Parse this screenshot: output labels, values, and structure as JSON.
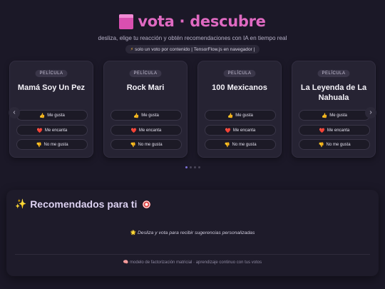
{
  "header": {
    "title": "vota · descubre",
    "tagline": "desliza, elige tu reacción y obtén recomendaciones con IA en tiempo real",
    "pill_text": "solo un voto por contenido | TensorFlow.js en navegador |",
    "pill_icon": "⚡"
  },
  "cards": [
    {
      "badge": "PELÍCULA",
      "title": "Mamá Soy Un Pez"
    },
    {
      "badge": "PELÍCULA",
      "title": "Rock Mari"
    },
    {
      "badge": "PELÍCULA",
      "title": "100 Mexicanos"
    },
    {
      "badge": "PELÍCULA",
      "title": "La Leyenda de La Nahuala"
    }
  ],
  "reactions": {
    "like": {
      "icon": "👍",
      "label": "Me gusta"
    },
    "love": {
      "icon": "❤️",
      "label": "Me encanta"
    },
    "dislike": {
      "icon": "👎",
      "label": "No me gusta"
    }
  },
  "carousel": {
    "prev_icon": "‹",
    "next_icon": "›",
    "page_count": 4,
    "active_page": 1
  },
  "recommendations": {
    "title": "Recomendados para ti",
    "title_icon": "✨",
    "empty_icon": "🌟",
    "empty_text": "Desliza y vota para recibir sugerencias personalizadas",
    "footer_icon": "🧠",
    "footer_text": "modelo de factorización matricial · aprendizaje continuo con tus votos"
  },
  "colors": {
    "accent": "#e06ac2",
    "background": "#1b1827",
    "card": "#262333",
    "active_dot": "#7c6fd6"
  }
}
